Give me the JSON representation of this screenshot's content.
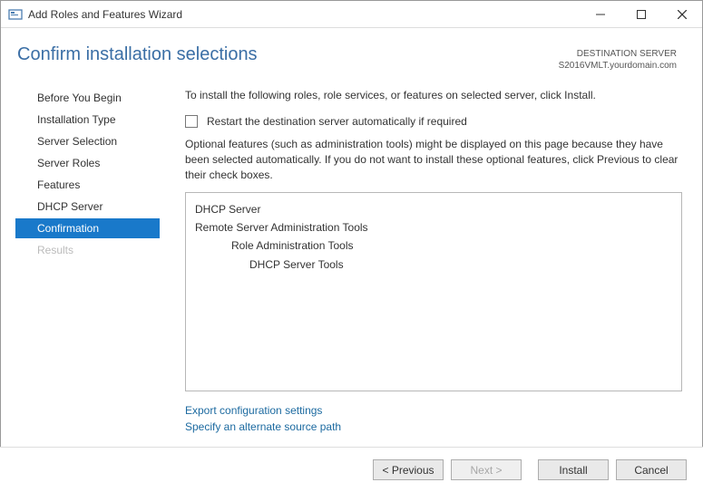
{
  "titlebar": {
    "title": "Add Roles and Features Wizard"
  },
  "header": {
    "page_title": "Confirm installation selections",
    "dest_label": "DESTINATION SERVER",
    "dest_server": "S2016VMLT.yourdomain.com"
  },
  "sidebar": {
    "items": [
      {
        "label": "Before You Begin",
        "state": "normal"
      },
      {
        "label": "Installation Type",
        "state": "normal"
      },
      {
        "label": "Server Selection",
        "state": "normal"
      },
      {
        "label": "Server Roles",
        "state": "normal"
      },
      {
        "label": "Features",
        "state": "normal"
      },
      {
        "label": "DHCP Server",
        "state": "normal"
      },
      {
        "label": "Confirmation",
        "state": "selected"
      },
      {
        "label": "Results",
        "state": "disabled"
      }
    ]
  },
  "main": {
    "intro": "To install the following roles, role services, or features on selected server, click Install.",
    "restart_label": "Restart the destination server automatically if required",
    "optional_note": "Optional features (such as administration tools) might be displayed on this page because they have been selected automatically. If you do not want to install these optional features, click Previous to clear their check boxes.",
    "selections": [
      {
        "text": "DHCP Server",
        "indent": 0
      },
      {
        "text": "Remote Server Administration Tools",
        "indent": 0
      },
      {
        "text": "Role Administration Tools",
        "indent": 1
      },
      {
        "text": "DHCP Server Tools",
        "indent": 2
      }
    ],
    "link_export": "Export configuration settings",
    "link_altpath": "Specify an alternate source path"
  },
  "footer": {
    "previous": "< Previous",
    "next": "Next >",
    "install": "Install",
    "cancel": "Cancel"
  }
}
